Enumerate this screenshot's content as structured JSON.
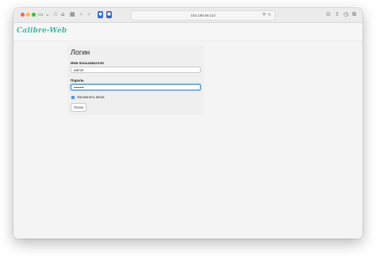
{
  "browser": {
    "address": "192.168.68.110",
    "icons": {
      "sidebar": "sidebar-icon",
      "chevron": "chevron-down-icon",
      "star": "star-icon",
      "shield": "shield-icon",
      "grid": "grid-icon",
      "back": "back-icon",
      "forward": "forward-icon",
      "ext1": "extension-icon",
      "ext2": "extension-icon",
      "reload": "reload-icon",
      "new_tab": "plus-icon",
      "download": "download-icon",
      "share": "share-icon",
      "history": "history-icon",
      "tabs": "tabs-icon"
    }
  },
  "header": {
    "brand": "Calibre-Web"
  },
  "login": {
    "title": "Логин",
    "username_label": "Имя пользователя",
    "username_value": "admin",
    "password_label": "Пароль",
    "password_value": "••••••••",
    "remember_label": "Запомнить меня",
    "remember_checked": true,
    "submit_label": "Логин"
  },
  "colors": {
    "brand": "#3cb9a5",
    "focus_border": "#4a90e2",
    "checkbox": "#3b82f6"
  }
}
